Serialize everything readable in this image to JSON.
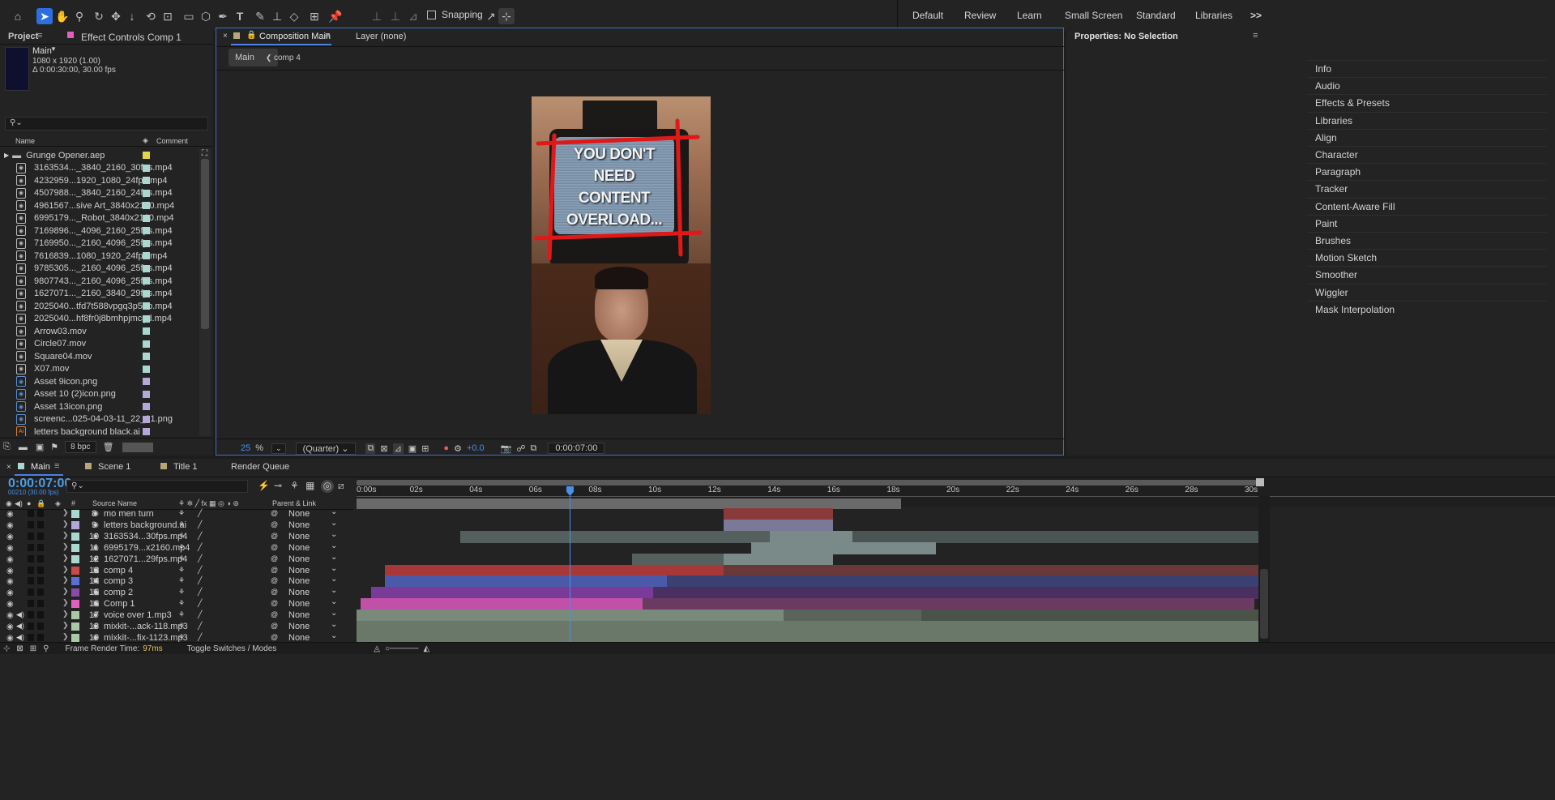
{
  "toolbar": {
    "snapping_label": "Snapping",
    "workspaces": [
      "Default",
      "Review",
      "Learn",
      "Small Screen",
      "Standard",
      "Libraries"
    ],
    "overflow": ">>"
  },
  "project_panel": {
    "tab_project": "Project",
    "tab_effect_controls": "Effect Controls Comp 1",
    "comp_name": "Main",
    "comp_size": "1080 x 1920 (1.00)",
    "comp_duration": "Δ 0:00:30:00, 30.00 fps",
    "col_name": "Name",
    "col_comment": "Comment",
    "items": [
      {
        "name": "Grunge Opener.aep",
        "type": "folder",
        "color": "#e2d34a"
      },
      {
        "name": "3163534..._3840_2160_30fps.mp4",
        "type": "video",
        "color": "#a8d8d0"
      },
      {
        "name": "4232959...1920_1080_24fps.mp4",
        "type": "video",
        "color": "#a8d8d0"
      },
      {
        "name": "4507988..._3840_2160_24fps.mp4",
        "type": "video",
        "color": "#a8d8d0"
      },
      {
        "name": "4961567...sive Art_3840x2160.mp4",
        "type": "video",
        "color": "#a8d8d0"
      },
      {
        "name": "6995179..._Robot_3840x2160.mp4",
        "type": "video",
        "color": "#a8d8d0"
      },
      {
        "name": "7169896..._4096_2160_25fps.mp4",
        "type": "video",
        "color": "#a8d8d0"
      },
      {
        "name": "7169950..._2160_4096_25fps.mp4",
        "type": "video",
        "color": "#a8d8d0"
      },
      {
        "name": "7616839...1080_1920_24fps.mp4",
        "type": "video",
        "color": "#a8d8d0"
      },
      {
        "name": "9785305..._2160_4096_25fps.mp4",
        "type": "video",
        "color": "#a8d8d0"
      },
      {
        "name": "9807743..._2160_4096_25fps.mp4",
        "type": "video",
        "color": "#a8d8d0"
      },
      {
        "name": "1627071..._2160_3840_29fps.mp4",
        "type": "video",
        "color": "#a8d8d0"
      },
      {
        "name": "2025040...tfd7t588vpgq3p5bb.mp4",
        "type": "video",
        "color": "#a8d8d0"
      },
      {
        "name": "2025040...hf8fr0j8bmhpjmcgd.mp4",
        "type": "video",
        "color": "#a8d8d0"
      },
      {
        "name": "Arrow03.mov",
        "type": "video",
        "color": "#a8d8d0"
      },
      {
        "name": "Circle07.mov",
        "type": "video",
        "color": "#a8d8d0"
      },
      {
        "name": "Square04.mov",
        "type": "video",
        "color": "#a8d8d0"
      },
      {
        "name": "X07.mov",
        "type": "video",
        "color": "#a8d8d0"
      },
      {
        "name": "Asset 9icon.png",
        "type": "image",
        "color": "#b3a8d8"
      },
      {
        "name": "Asset 10 (2)icon.png",
        "type": "image",
        "color": "#b3a8d8"
      },
      {
        "name": "Asset 13icon.png",
        "type": "image",
        "color": "#b3a8d8"
      },
      {
        "name": "screenc...025-04-03-11_22_01.png",
        "type": "image",
        "color": "#b3a8d8"
      },
      {
        "name": "letters background black.ai",
        "type": "ai",
        "color": "#b3a8d8"
      }
    ],
    "bpc": "8 bpc"
  },
  "composition_panel": {
    "tab_label": "Composition Main",
    "layer_label": "Layer (none)",
    "crumb_main": "Main",
    "crumb_comp": "comp 4",
    "preview_text": [
      "YOU DON'T",
      "NEED",
      "CONTENT",
      "OVERLOAD..."
    ],
    "zoom": "25",
    "zoom_unit": "%",
    "resolution": "(Quarter)",
    "exposure": "+0.0",
    "timecode": "0:00:07:00"
  },
  "properties_panel": {
    "title": "Properties: No Selection",
    "items": [
      "Info",
      "Audio",
      "Effects & Presets",
      "Libraries",
      "Align",
      "Character",
      "Paragraph",
      "Tracker",
      "Content-Aware Fill",
      "Paint",
      "Brushes",
      "Motion Sketch",
      "Smoother",
      "Wiggler",
      "Mask Interpolation"
    ]
  },
  "timeline": {
    "tabs": [
      "Main",
      "Scene 1",
      "Title 1",
      "Render Queue"
    ],
    "tab_colors": [
      "#a8d8d0",
      "#b9a57a",
      "#b9a57a",
      ""
    ],
    "timecode": "0:00:07:00",
    "frame_info": "00210 (30.00 fps)",
    "col_source": "Source Name",
    "col_parent": "Parent & Link",
    "ruler": [
      "0:00s",
      "02s",
      "04s",
      "06s",
      "08s",
      "10s",
      "12s",
      "14s",
      "16s",
      "18s",
      "20s",
      "22s",
      "24s",
      "26s",
      "28s",
      "30s"
    ],
    "layers": [
      {
        "num": "8",
        "name": "mo men turn",
        "parent": "None",
        "color": "#a8d8d0"
      },
      {
        "num": "9",
        "name": "letters background.ai",
        "parent": "None",
        "color": "#b3a8d8"
      },
      {
        "num": "10",
        "name": "3163534...30fps.mp4",
        "parent": "None",
        "color": "#a8d8d0"
      },
      {
        "num": "11",
        "name": "6995179...x2160.mp4",
        "parent": "None",
        "color": "#a8d8d0"
      },
      {
        "num": "12",
        "name": "1627071...29fps.mp4",
        "parent": "None",
        "color": "#a8d8d0"
      },
      {
        "num": "13",
        "name": "comp 4",
        "parent": "None",
        "color": "#c84a4a"
      },
      {
        "num": "14",
        "name": "comp 3",
        "parent": "None",
        "color": "#5a6fd8"
      },
      {
        "num": "15",
        "name": "comp 2",
        "parent": "None",
        "color": "#8a4aa8"
      },
      {
        "num": "16",
        "name": "Comp 1",
        "parent": "None",
        "color": "#e060c0"
      },
      {
        "num": "17",
        "name": "voice over 1.mp3",
        "parent": "None",
        "color": "#a8c8a8"
      },
      {
        "num": "18",
        "name": "mixkit-...ack-118.mp3",
        "parent": "None",
        "color": "#a8c8a8"
      },
      {
        "num": "19",
        "name": "mixkit-...fix-1123.mp3",
        "parent": "None",
        "color": "#a8c8a8"
      }
    ],
    "footer_render_label": "Frame Render Time:",
    "footer_render_value": "97ms",
    "footer_toggle": "Toggle Switches / Modes"
  }
}
